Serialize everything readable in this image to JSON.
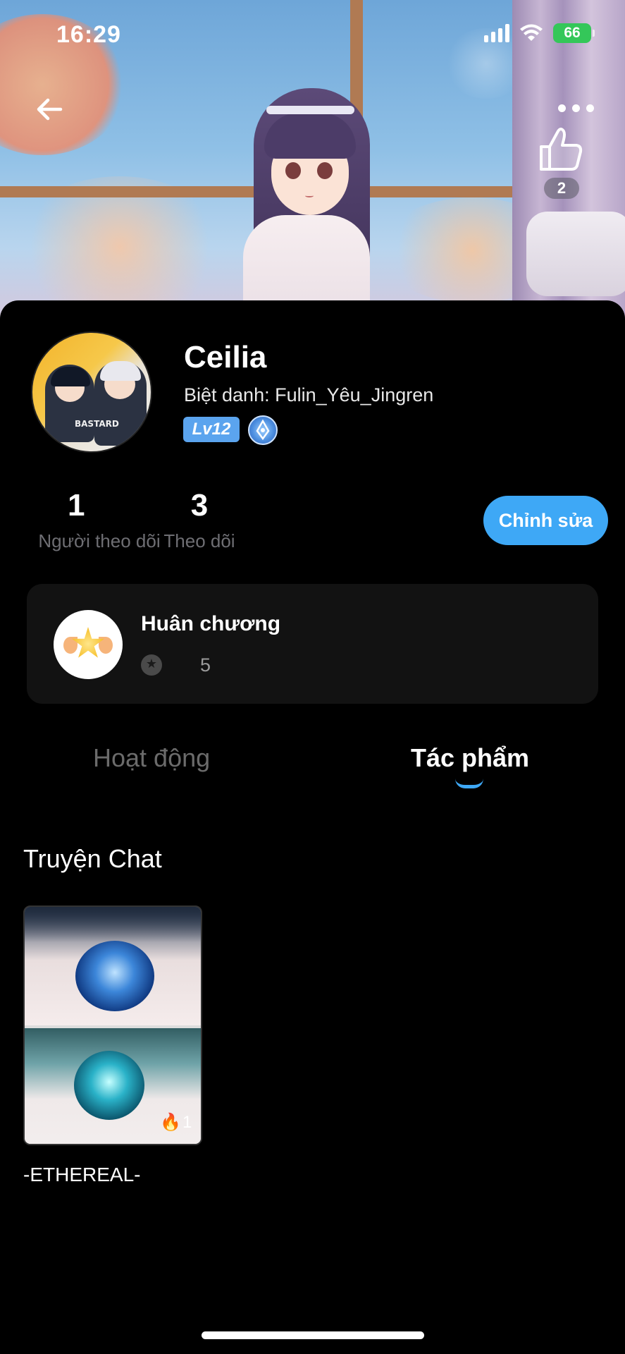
{
  "status_bar": {
    "time": "16:29",
    "battery": "66"
  },
  "header": {
    "like_count": "2",
    "icons": [
      "back-arrow-icon",
      "more-dots-icon",
      "thumbs-up-icon"
    ]
  },
  "profile": {
    "name": "Ceilia",
    "nickname": "Biệt danh: Fulin_Yêu_Jingren",
    "level": "Lv12",
    "avatar_text": "BASTARD"
  },
  "stats": {
    "followers_count": "1",
    "followers_label": "Người theo dõi",
    "following_count": "3",
    "following_label": "Theo dõi"
  },
  "edit_button": "Chỉnh sửa",
  "medals": {
    "title": "Huân chương",
    "count": "5"
  },
  "tabs": [
    {
      "label": "Hoạt động",
      "active": false
    },
    {
      "label": "Tác phẩm",
      "active": true
    }
  ],
  "section": {
    "title": "Truyện Chat"
  },
  "stories": [
    {
      "title": "-ETHEREAL-",
      "hot_count": "1"
    }
  ],
  "colors": {
    "accent": "#3ea8f6",
    "background": "#000000",
    "card": "#121212",
    "level_badge": "#5ba4ee",
    "battery": "#34c759"
  }
}
